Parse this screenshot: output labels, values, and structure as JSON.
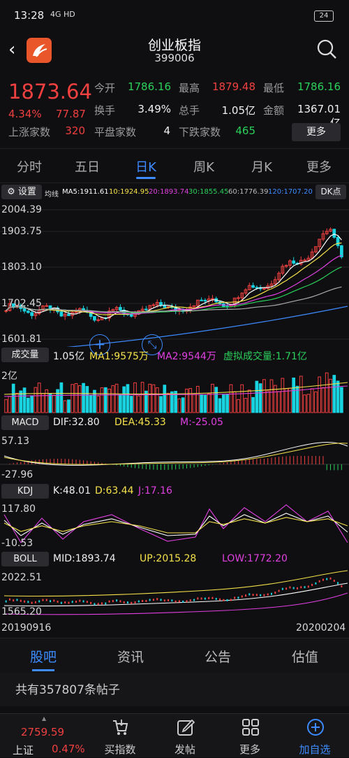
{
  "status_bar": {
    "time": "13:28",
    "network": "4G HD",
    "battery": "24"
  },
  "header": {
    "title": "创业板指",
    "code": "399006"
  },
  "quote": {
    "price": "1873.64",
    "change_pct": "4.34%",
    "change_abs": "77.87",
    "open_label": "今开",
    "open": "1786.16",
    "high_label": "最高",
    "high": "1879.48",
    "low_label": "最低",
    "low": "1786.16",
    "turnover_label": "换手",
    "turnover": "3.49%",
    "volume_label": "总手",
    "volume": "1.05亿",
    "amount_label": "金额",
    "amount": "1367.01亿",
    "up_label": "上涨家数",
    "up_count": "320",
    "flat_label": "平盘家数",
    "flat_count": "4",
    "down_label": "下跌家数",
    "down_count": "465",
    "more_label": "更多"
  },
  "tabs": [
    "分时",
    "五日",
    "日K",
    "周K",
    "月K",
    "更多"
  ],
  "active_tab": "日K",
  "ma_bar": {
    "settings_label": "设置",
    "prefix": "均线",
    "ma5": "MA5:1911.61",
    "ma10": "10:1924.95",
    "ma20": "20:1893.74",
    "ma30": "30:1855.45",
    "ma60": "60:1776.39",
    "ma120": "120:1707.20",
    "dk_label": "DK点"
  },
  "price_axis": [
    "2004.39",
    "1903.75",
    "1803.10",
    "1702.45",
    "1601.81"
  ],
  "volume_panel": {
    "label": "成交量",
    "vol": "1.05亿",
    "ma1": "MA1:9575万",
    "ma2": "MA2:9544万",
    "virtual": "虚拟成交量:1.71亿",
    "axis_top": "2亿"
  },
  "macd_panel": {
    "label": "MACD",
    "dif": "DIF:32.80",
    "dea": "DEA:45.33",
    "m": "M:-25.05",
    "axis_top": "57.13",
    "axis_bottom": "-27.96"
  },
  "kdj_panel": {
    "label": "KDJ",
    "k": "K:48.01",
    "d": "D:63.44",
    "j": "J:17.16",
    "axis_top": "117.80",
    "axis_bottom": "-10.53"
  },
  "boll_panel": {
    "label": "BOLL",
    "mid": "MID:1893.74",
    "up": "UP:2015.28",
    "low": "LOW:1772.20",
    "axis_top": "2022.51",
    "axis_bottom": "1565.20"
  },
  "date_range": {
    "start": "20190916",
    "end": "20200204"
  },
  "bottom_tabs": [
    "股吧",
    "资讯",
    "公告",
    "估值"
  ],
  "active_bottom_tab": "股吧",
  "posts_text": "共有357807条帖子",
  "nav": {
    "index_value": "2759.59",
    "index_name": "上证",
    "index_pct": "0.47%",
    "items": [
      "买指数",
      "发帖",
      "更多",
      "加自选"
    ]
  },
  "colors": {
    "up": "#f0403f",
    "down": "#19d3e0",
    "accent": "#3d8bff"
  }
}
